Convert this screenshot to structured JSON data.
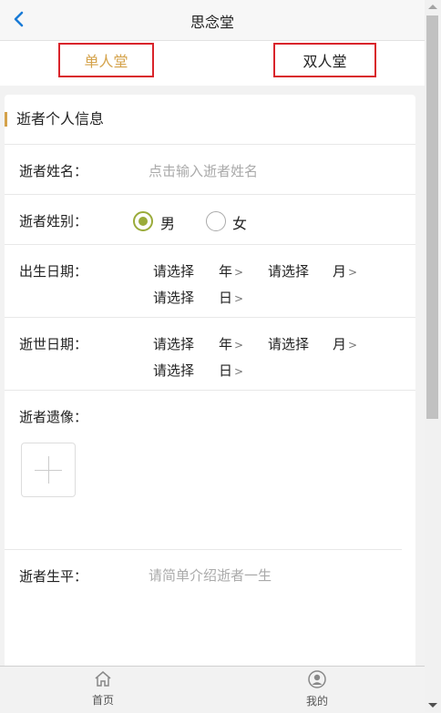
{
  "header": {
    "title": "思念堂",
    "back_icon": "chevron-left-icon"
  },
  "tabs": [
    {
      "label": "单人堂",
      "active": true
    },
    {
      "label": "双人堂",
      "active": false
    }
  ],
  "section": {
    "title": "逝者个人信息",
    "accent_color": "#d4a24a"
  },
  "form": {
    "name": {
      "label": "逝者姓名：",
      "placeholder": "点击输入逝者姓名"
    },
    "gender": {
      "label": "逝者姓别：",
      "options": [
        "男",
        "女"
      ],
      "selected": "男"
    },
    "birth": {
      "label": "出生日期：",
      "year": "请选择",
      "year_unit": "年",
      "month": "请选择",
      "month_unit": "月",
      "day": "请选择",
      "day_unit": "日"
    },
    "death": {
      "label": "逝世日期：",
      "year": "请选择",
      "year_unit": "年",
      "month": "请选择",
      "month_unit": "月",
      "day": "请选择",
      "day_unit": "日"
    },
    "portrait": {
      "label": "逝者遗像：",
      "upload_icon": "plus-icon"
    },
    "bio": {
      "label": "逝者生平：",
      "placeholder": "请简单介绍逝者一生"
    }
  },
  "tabbar": [
    {
      "label": "首页",
      "icon": "home-icon"
    },
    {
      "label": "我的",
      "icon": "user-icon"
    }
  ],
  "colors": {
    "radio_selected": "#9aab3a",
    "tab_active_text": "#d4a24a",
    "highlight_border": "#d9242b"
  }
}
